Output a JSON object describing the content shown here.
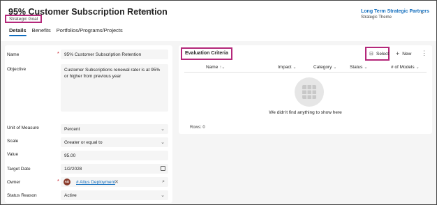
{
  "header": {
    "title": "95% Customer Subscription Retention",
    "saved_status": "- Saved",
    "entity_type": "Strategic Goal",
    "related_link": "Long Term Strategic Partners",
    "related_type": "Strategic Theme"
  },
  "tabs": [
    {
      "label": "Details",
      "active": true
    },
    {
      "label": "Benefits",
      "active": false
    },
    {
      "label": "Portfolios/Programs/Projects",
      "active": false
    }
  ],
  "form": {
    "name": {
      "label": "Name",
      "required": "*",
      "value": "95% Customer Subscription Retention"
    },
    "objective": {
      "label": "Objective",
      "value": "Customer Subscriptions renewal rater is at 95% or higher from previous year"
    },
    "unit_of_measure": {
      "label": "Unit of Measure",
      "value": "Percent"
    },
    "scale": {
      "label": "Scale",
      "value": "Greater or equal to"
    },
    "value": {
      "label": "Value",
      "value": "95.00"
    },
    "target_date": {
      "label": "Target Date",
      "value": "1/2/2028"
    },
    "owner": {
      "label": "Owner",
      "required": "*",
      "initials": "AD",
      "value": "# Altus Deployment"
    },
    "status_reason": {
      "label": "Status Reason",
      "value": "Active"
    }
  },
  "evaluation": {
    "title": "Evaluation Criteria",
    "select_label": "Select",
    "new_label": "New",
    "columns": [
      {
        "label": "Name",
        "sort": "↑⌄"
      },
      {
        "label": "Impact",
        "sort": "⌄"
      },
      {
        "label": "Category",
        "sort": "⌄"
      },
      {
        "label": "Status",
        "sort": "⌄"
      },
      {
        "label": "# of Models",
        "sort": "⌄"
      }
    ],
    "empty_message": "We didn't find anything to show here",
    "rows_count": "Rows: 0"
  },
  "colors": {
    "accent": "#0f6cbd",
    "highlight_border": "#b4287a",
    "required": "#c50f1f"
  }
}
